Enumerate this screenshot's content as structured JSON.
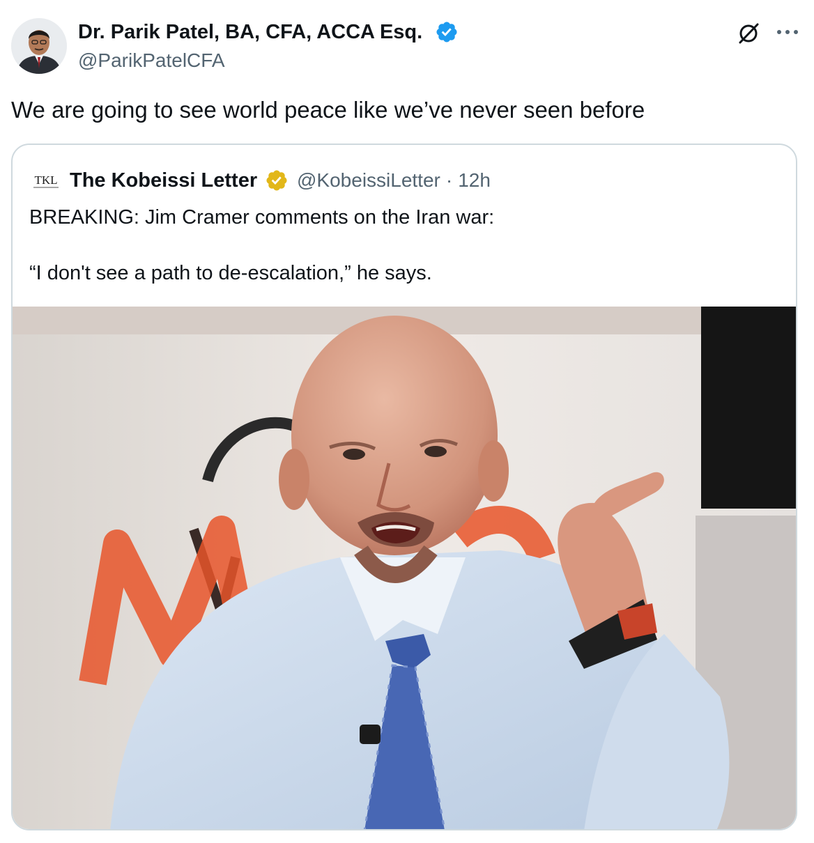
{
  "tweet": {
    "author": {
      "name": "Dr. Parik Patel, BA, CFA, ACCA Esq.",
      "handle": "@ParikPatelCFA",
      "verified_color": "#1d9bf0"
    },
    "text": "We are going to see world peace like we’ve never seen before",
    "header_icons": [
      "grok-icon",
      "more-icon"
    ]
  },
  "quote": {
    "author": {
      "avatar_text": "TKL",
      "name": "The Kobeissi Letter",
      "handle": "@KobeissiLetter",
      "separator": "·",
      "time": "12h",
      "verified_color": "#e2b719"
    },
    "lines": [
      "BREAKING: Jim Cramer comments on the Iran war:",
      "“I don't see a path to de-escalation,” he says."
    ]
  },
  "colors": {
    "text": "#0f1419",
    "secondary": "#536471",
    "border": "#cfd9de",
    "accent_orange": "#e8552a"
  }
}
